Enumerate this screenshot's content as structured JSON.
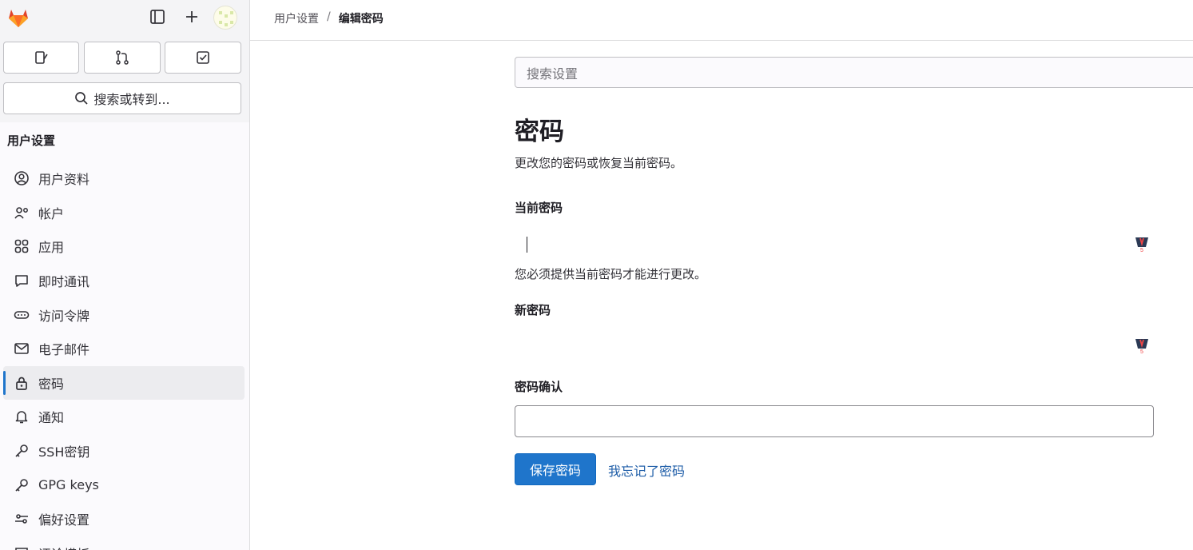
{
  "sidebar": {
    "search_label": "搜索或转到...",
    "section_title": "用户设置",
    "items": [
      {
        "label": "用户资料",
        "icon": "profile-icon"
      },
      {
        "label": "帐户",
        "icon": "account-icon"
      },
      {
        "label": "应用",
        "icon": "applications-icon"
      },
      {
        "label": "即时通讯",
        "icon": "chat-icon"
      },
      {
        "label": "访问令牌",
        "icon": "token-icon"
      },
      {
        "label": "电子邮件",
        "icon": "mail-icon"
      },
      {
        "label": "密码",
        "icon": "lock-icon",
        "active": true
      },
      {
        "label": "通知",
        "icon": "bell-icon"
      },
      {
        "label": "SSH密钥",
        "icon": "key-icon"
      },
      {
        "label": "GPG keys",
        "icon": "key-icon"
      },
      {
        "label": "偏好设置",
        "icon": "preferences-icon"
      },
      {
        "label": "评论模板",
        "icon": "comment-template-icon"
      }
    ]
  },
  "breadcrumb": {
    "parent": "用户设置",
    "separator": "/",
    "current": "编辑密码"
  },
  "main": {
    "settings_search_placeholder": "搜索设置",
    "title": "密码",
    "description": "更改您的密码或恢复当前密码。",
    "current_password_label": "当前密码",
    "current_password_hint": "您必须提供当前密码才能进行更改。",
    "new_password_label": "新密码",
    "confirm_password_label": "密码确认",
    "save_button": "保存密码",
    "forgot_link": "我忘记了密码"
  },
  "colors": {
    "accent": "#1f75cb",
    "link": "#1f5ea8"
  }
}
